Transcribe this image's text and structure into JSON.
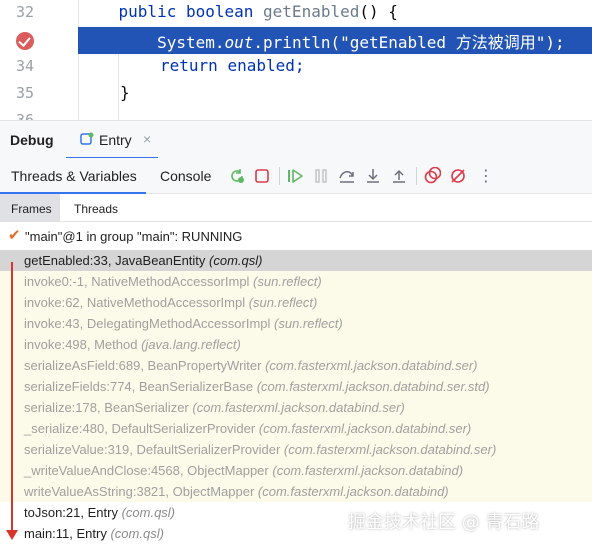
{
  "editor": {
    "lines": [
      {
        "num": "32",
        "pre": "    ",
        "kw": "public boolean ",
        "rest": "getEnabled",
        "post": "() {"
      },
      {
        "num": "",
        "code_a": "        System.",
        "code_italic": "out",
        "code_b": ".println(\"getEnabled 方法被调用\");"
      },
      {
        "num": "34",
        "kw": "return ",
        "rest": "enabled;"
      },
      {
        "num": "35",
        "code": "}"
      },
      {
        "num": "36"
      }
    ]
  },
  "debug": {
    "title": "Debug",
    "tab_label": "Entry",
    "tab_close": "×"
  },
  "toolbar": {
    "threads_variables": "Threads & Variables",
    "console": "Console",
    "icons": [
      "rerun-icon",
      "stop-icon",
      "resume-icon",
      "pause-icon",
      "step-over-icon",
      "step-into-icon",
      "step-out-icon",
      "view-breakpoints-icon",
      "mute-breakpoints-icon",
      "more-icon"
    ],
    "more_glyph": "⋮"
  },
  "subtabs": {
    "frames": "Frames",
    "threads": "Threads"
  },
  "thread": {
    "check": "✔",
    "label": "\"main\"@1 in group \"main\": RUNNING"
  },
  "frames": [
    {
      "method": "getEnabled:33, JavaBeanEntity ",
      "pkg": "(com.qsl)",
      "kind": "selected"
    },
    {
      "method": "invoke0:-1, NativeMethodAccessorImpl ",
      "pkg": "(sun.reflect)",
      "kind": "lib"
    },
    {
      "method": "invoke:62, NativeMethodAccessorImpl ",
      "pkg": "(sun.reflect)",
      "kind": "lib"
    },
    {
      "method": "invoke:43, DelegatingMethodAccessorImpl ",
      "pkg": "(sun.reflect)",
      "kind": "lib"
    },
    {
      "method": "invoke:498, Method ",
      "pkg": "(java.lang.reflect)",
      "kind": "lib"
    },
    {
      "method": "serializeAsField:689, BeanPropertyWriter ",
      "pkg": "(com.fasterxml.jackson.databind.ser)",
      "kind": "lib"
    },
    {
      "method": "serializeFields:774, BeanSerializerBase ",
      "pkg": "(com.fasterxml.jackson.databind.ser.std)",
      "kind": "lib"
    },
    {
      "method": "serialize:178, BeanSerializer ",
      "pkg": "(com.fasterxml.jackson.databind.ser)",
      "kind": "lib"
    },
    {
      "method": "_serialize:480, DefaultSerializerProvider ",
      "pkg": "(com.fasterxml.jackson.databind.ser)",
      "kind": "lib"
    },
    {
      "method": "serializeValue:319, DefaultSerializerProvider ",
      "pkg": "(com.fasterxml.jackson.databind.ser)",
      "kind": "lib"
    },
    {
      "method": "_writeValueAndClose:4568, ObjectMapper ",
      "pkg": "(com.fasterxml.jackson.databind)",
      "kind": "lib"
    },
    {
      "method": "writeValueAsString:3821, ObjectMapper ",
      "pkg": "(com.fasterxml.jackson.databind)",
      "kind": "lib"
    },
    {
      "method": "toJson:21, Entry ",
      "pkg": "(com.qsl)",
      "kind": "normal"
    },
    {
      "method": "main:11, Entry ",
      "pkg": "(com.qsl)",
      "kind": "normal"
    }
  ],
  "watermark": "掘金技术社区 @ 青石路",
  "colors": {
    "current_line": "#2154b5",
    "breakpoint": "#db5c5c",
    "library_frame_bg": "#fcfae8",
    "selected_frame_bg": "#d5d5d5",
    "call_arrow": "#d9342b",
    "accent": "#3574f0"
  }
}
